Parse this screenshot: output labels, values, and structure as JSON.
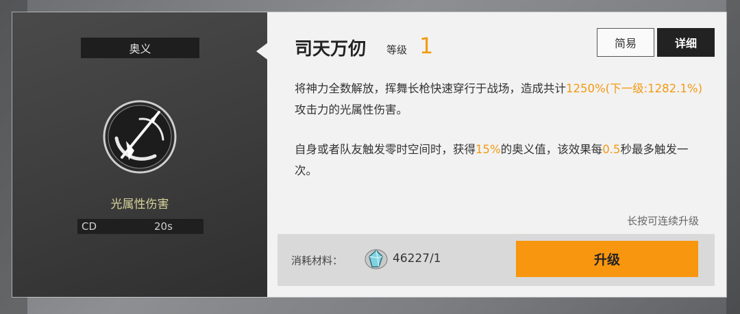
{
  "left_panel": {
    "tag": "奥义",
    "skill_icon": "spear-slash-icon",
    "element_label": "光属性伤害",
    "cd_label": "CD",
    "cd_value": "20s"
  },
  "skill": {
    "name": "司天万仞",
    "level_label": "等级",
    "level": "1"
  },
  "mode_toggle": {
    "simple": "简易",
    "detail": "详细",
    "active": "detail"
  },
  "description": {
    "p1": [
      {
        "text": "将神力全数解放，挥舞长枪快速穿行于战场，造成共计",
        "highlight": false
      },
      {
        "text": "1250%(下一级:1282.1%)",
        "highlight": true
      },
      {
        "text": "攻击力的光属性伤害。",
        "highlight": false
      }
    ],
    "p2": [
      {
        "text": "自身或者队友触发零时空间时，获得",
        "highlight": false
      },
      {
        "text": "15%",
        "highlight": true
      },
      {
        "text": "的奥义值，该效果每",
        "highlight": false
      },
      {
        "text": "0.5",
        "highlight": true
      },
      {
        "text": "秒最多触发一次。",
        "highlight": false
      }
    ]
  },
  "hint": "长按可连续升级",
  "cost": {
    "label": "消耗材料：",
    "material_icon": "crystal-material-icon",
    "count": "46227/1"
  },
  "upgrade_button": "升级",
  "colors": {
    "accent": "#f39a11",
    "button": "#f8960f",
    "element_text": "#d8d49a"
  }
}
